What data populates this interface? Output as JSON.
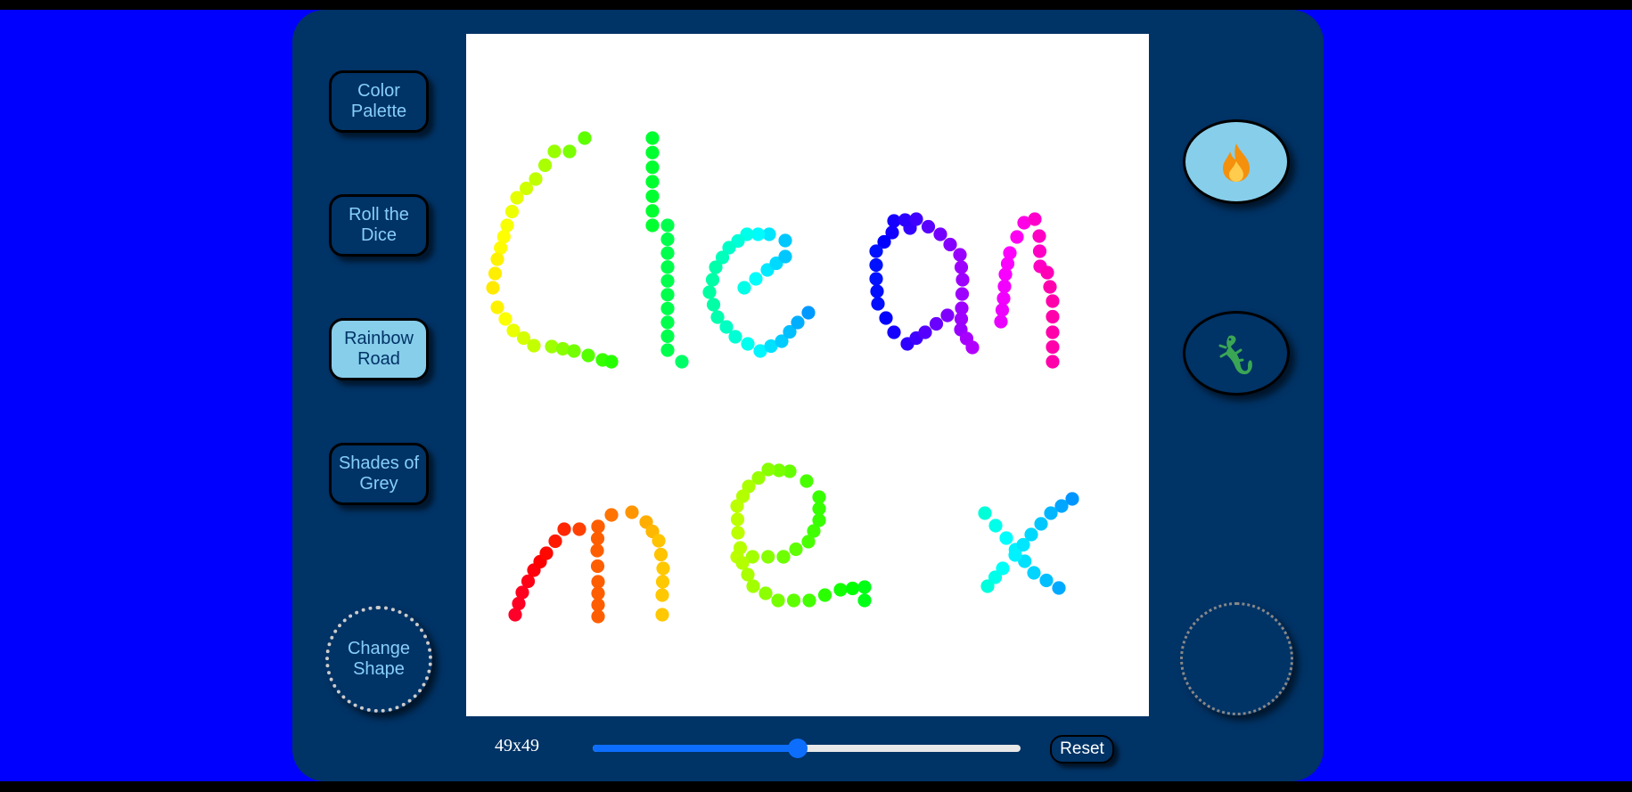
{
  "buttons": {
    "color_palette": "Color Palette",
    "roll_dice": "Roll the Dice",
    "rainbow_road": "Rainbow Road",
    "shades_grey": "Shades of Grey",
    "change_shape": "Change Shape",
    "reset": "Reset"
  },
  "active_mode": "rainbow_road",
  "icons": {
    "fire_button": "fire-icon",
    "lizard_button": "lizard-icon"
  },
  "grid": {
    "size_label": "49x49",
    "slider_fraction": 0.48
  },
  "colors": {
    "background": "#0000fe",
    "frame": "#003366",
    "button_text": "#87cefa",
    "active_button": "#87ceeb",
    "slider_accent": "#0d6efd"
  },
  "drawing": {
    "text": "Clean me x",
    "dot_color_mode": "rainbow"
  }
}
